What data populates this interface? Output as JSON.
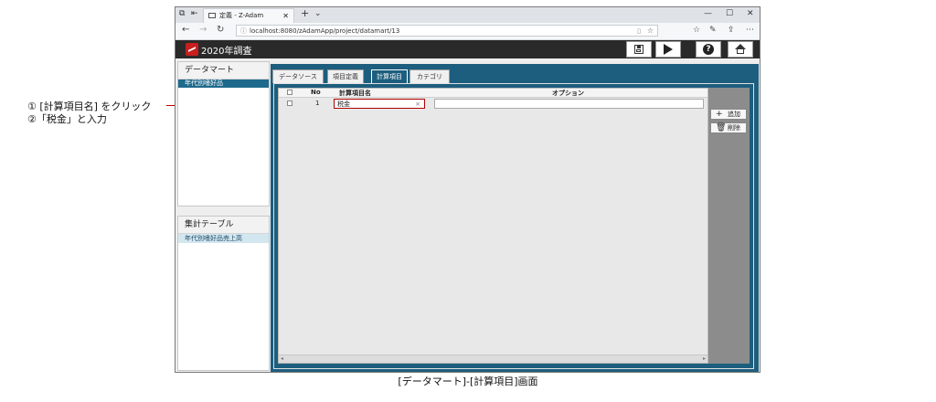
{
  "annotation": {
    "step1": "① [計算項目名] をクリック",
    "step2": "②「税金」と入力",
    "caption": "[データマート]-[計算項目]画面"
  },
  "browser": {
    "tab_title": "定義 - Z-Adam",
    "url": "localhost:8080/zAdamApp/project/datamart/13"
  },
  "app": {
    "title": "2020年調査"
  },
  "left": {
    "datamart": {
      "header": "データマート",
      "items": [
        "年代別嗜好品"
      ]
    },
    "aggregate": {
      "header": "集計テーブル",
      "items": [
        "年代別嗜好品売上高"
      ]
    }
  },
  "tabs": [
    "データソース",
    "項目定義",
    "計算項目",
    "カテゴリ"
  ],
  "active_tab": "計算項目",
  "grid": {
    "columns": [
      "No",
      "計算項目名",
      "オプション"
    ],
    "rows": [
      {
        "no": "1",
        "name": "税金",
        "option": ""
      }
    ]
  },
  "side_buttons": {
    "add": "追加",
    "delete": "削除"
  }
}
